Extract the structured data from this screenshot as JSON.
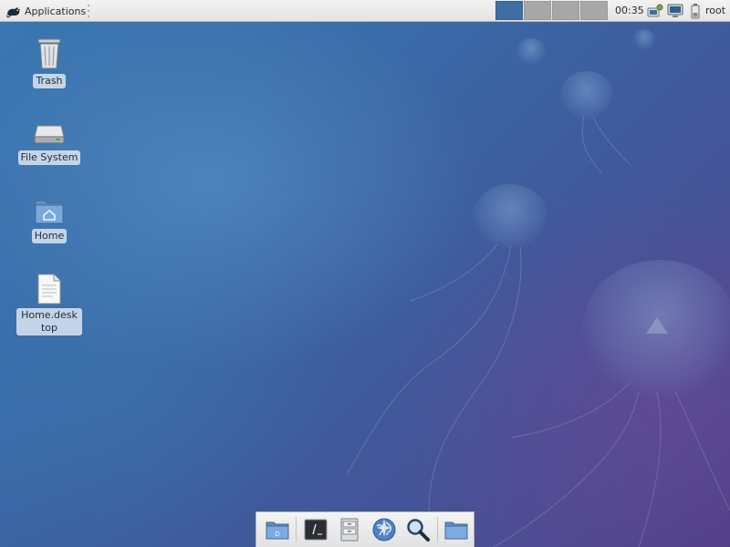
{
  "top_panel": {
    "applications_label": "Applications",
    "clock": "00:35",
    "user": "root",
    "workspaces": [
      {
        "active": true
      },
      {
        "active": false
      },
      {
        "active": false
      },
      {
        "active": false
      }
    ],
    "tray_icons": [
      "network-icon",
      "display-icon",
      "battery-icon"
    ]
  },
  "desktop": {
    "icons": [
      {
        "name": "trash-icon",
        "label": "Trash"
      },
      {
        "name": "drive-icon",
        "label": "File System"
      },
      {
        "name": "home-folder-icon",
        "label": "Home"
      },
      {
        "name": "document-icon",
        "label": "Home.desktop"
      }
    ]
  },
  "dock": {
    "items": [
      "file-manager-icon",
      "terminal-icon",
      "file-cabinet-icon",
      "web-browser-icon",
      "search-icon",
      "folder-icon"
    ]
  },
  "colors": {
    "panel_bg": "#e9e9e9",
    "workspace_active": "#3f6ea3",
    "workspace_inactive": "#a7a7a7",
    "wallpaper_primary": "#3a6aa8"
  }
}
